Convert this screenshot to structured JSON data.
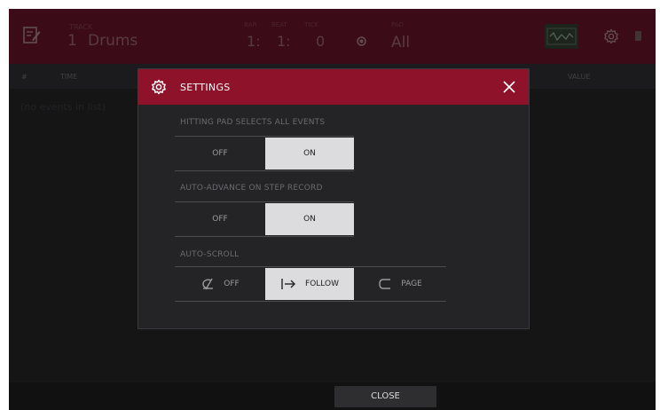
{
  "header": {
    "track_label": "TRACK",
    "track_number": "1",
    "track_name": "Drums",
    "position_labels": [
      "BAR",
      "BEAT",
      "TICK"
    ],
    "position": [
      "1:",
      "1:",
      "0"
    ],
    "pad_label": "PAD",
    "pad_value": "All"
  },
  "list": {
    "columns": [
      "#",
      "TIME",
      "VALUE"
    ],
    "empty_message": "(no events in list)"
  },
  "dialog": {
    "title": "SETTINGS",
    "sections": [
      {
        "label": "HITTING PAD SELECTS ALL EVENTS",
        "options": [
          {
            "label": "OFF",
            "selected": false
          },
          {
            "label": "ON",
            "selected": true
          }
        ]
      },
      {
        "label": "AUTO-ADVANCE ON STEP RECORD",
        "options": [
          {
            "label": "OFF",
            "selected": false
          },
          {
            "label": "ON",
            "selected": true
          }
        ]
      },
      {
        "label": "AUTO-SCROLL",
        "options": [
          {
            "label": "OFF",
            "icon": "autoscroll-off-icon",
            "selected": false
          },
          {
            "label": "FOLLOW",
            "icon": "follow-arrow-icon",
            "selected": true
          },
          {
            "label": "PAGE",
            "icon": "page-return-icon",
            "selected": false
          }
        ]
      }
    ]
  },
  "footer": {
    "close_label": "CLOSE"
  },
  "colors": {
    "header": "#7a1a32",
    "dialog_header": "#8e1229",
    "selected_option": "#dcdcde",
    "background": "#1c1c1e"
  }
}
